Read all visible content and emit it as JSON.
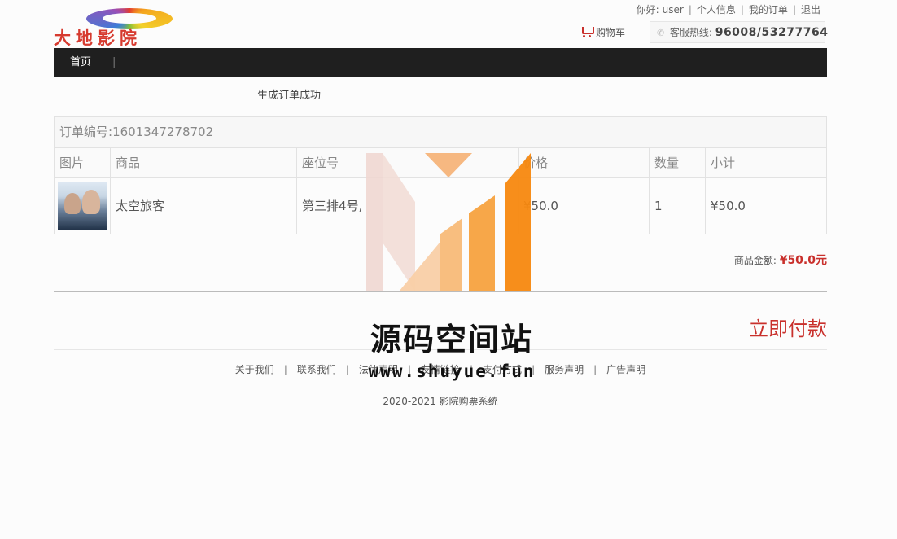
{
  "header": {
    "logo_text": "大地影院",
    "greeting": "你好:",
    "username": "user",
    "profile_link": "个人信息",
    "orders_link": "我的订单",
    "logout_link": "退出",
    "cart_label": "购物车",
    "hotline_label": "客服热线:",
    "hotline_number": "96008/53277764"
  },
  "nav": {
    "home": "首页",
    "separator": "|"
  },
  "message": "生成订单成功",
  "order": {
    "number_label": "订单编号:",
    "number": "1601347278702",
    "columns": [
      "图片",
      "商品",
      "座位号",
      "价格",
      "数量",
      "小计"
    ],
    "items": [
      {
        "product": "太空旅客",
        "seat": "第三排4号,",
        "price": "¥50.0",
        "quantity": "1",
        "subtotal": "¥50.0"
      }
    ],
    "total_label": "商品金额:",
    "total_value": "¥50.0元"
  },
  "pay_button": "立即付款",
  "footer": {
    "links": [
      "关于我们",
      "联系我们",
      "法律声明",
      "友情链接",
      "支付方式",
      "服务声明",
      "广告声明"
    ],
    "copyright": "2020-2021 影院购票系统"
  },
  "watermark": {
    "title": "源码空间站",
    "url": "www.shuyue.fun"
  },
  "colors": {
    "nav_bg": "#1f1f1f",
    "accent_red": "#c9302c",
    "watermark_orange": "#f7880f"
  }
}
